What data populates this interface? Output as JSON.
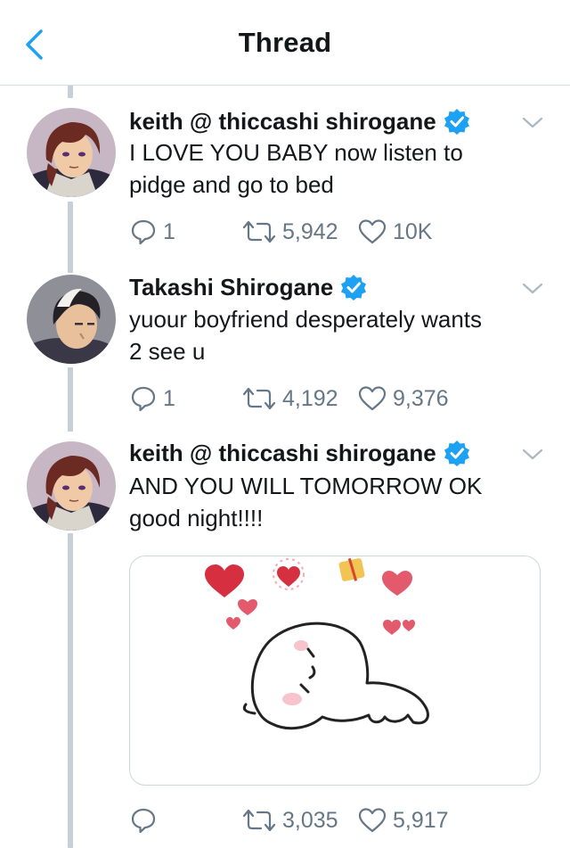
{
  "header": {
    "title": "Thread",
    "back_icon": "chevron-left-icon",
    "accent_color": "#1da1f2"
  },
  "tweets": [
    {
      "display_name": "keith @ thiccashi shirogane",
      "verified": true,
      "text_lines": [
        "I LOVE YOU BABY now listen to",
        "pidge and go to bed"
      ],
      "replies": "1",
      "retweets": "5,942",
      "likes": "10K"
    },
    {
      "display_name": "Takashi Shirogane",
      "verified": true,
      "text_lines": [
        "yuour boyfriend desperately wants",
        "2 see u"
      ],
      "replies": "1",
      "retweets": "4,192",
      "likes": "9,376"
    },
    {
      "display_name": "keith @ thiccashi shirogane",
      "verified": true,
      "text_lines": [
        "AND YOU WILL TOMORROW OK",
        "good night!!!!"
      ],
      "has_media": true,
      "replies": "",
      "retweets": "3,035",
      "likes": "5,917"
    }
  ],
  "colors": {
    "text": "#14171a",
    "secondary": "#657786",
    "verified": "#1da1f2",
    "thread_line": "#c7d0d8",
    "heart": "#e0405e"
  }
}
